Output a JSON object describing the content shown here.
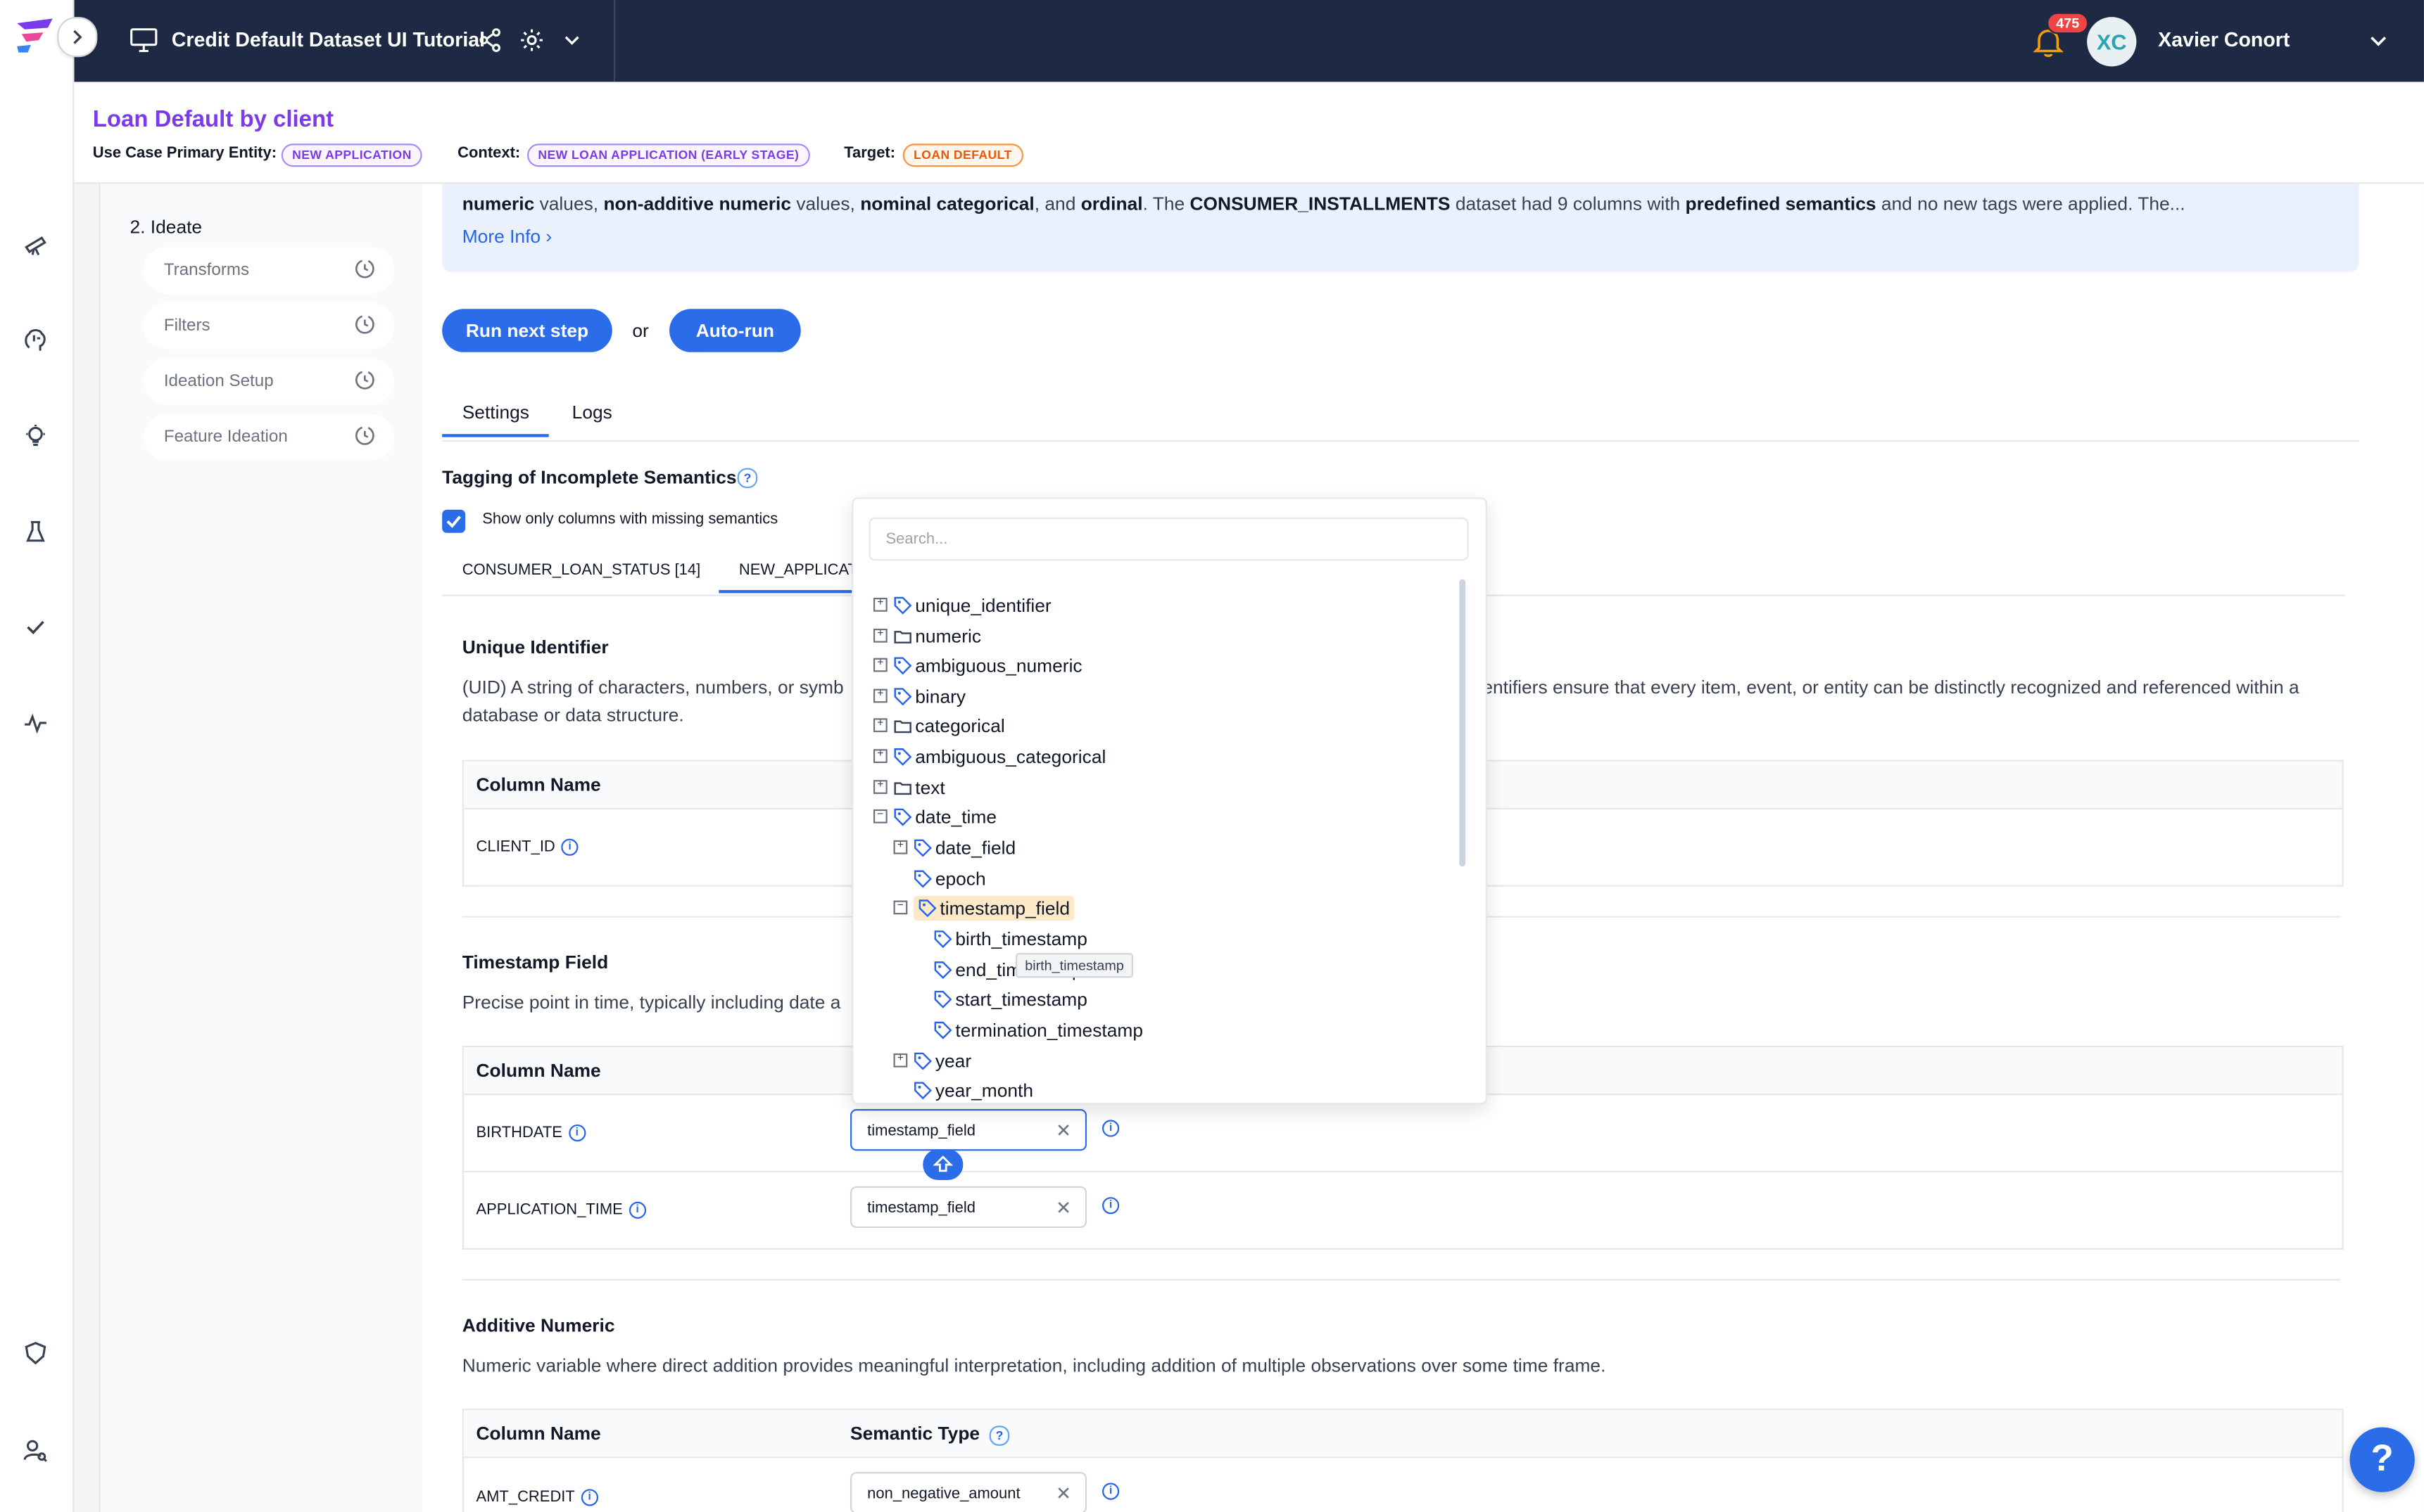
{
  "topbar": {
    "project_title": "Credit Default Dataset UI Tutorial",
    "notification_count": "475",
    "avatar_initials": "XC",
    "user_name": "Xavier Conort"
  },
  "header": {
    "title": "Loan Default by client",
    "entity_label": "Use Case Primary Entity:",
    "entity_value": "NEW APPLICATION",
    "context_label": "Context:",
    "context_value": "NEW LOAN APPLICATION (EARLY STAGE)",
    "target_label": "Target:",
    "target_value": "LOAN DEFAULT"
  },
  "steps": {
    "heading": "2. Ideate",
    "items": [
      {
        "label": "Transforms"
      },
      {
        "label": "Filters"
      },
      {
        "label": "Ideation Setup"
      },
      {
        "label": "Feature Ideation"
      }
    ]
  },
  "info": {
    "p1": "numeric",
    "p2": " values, ",
    "p3": "non-additive numeric",
    "p4": " values, ",
    "p5": "nominal categorical",
    "p6": ", and ",
    "p7": "ordinal",
    "p8": ". The ",
    "p9": "CONSUMER_INSTALLMENTS",
    "p10": " dataset had 9 columns with ",
    "p11": "predefined semantics",
    "p12": " and no new tags were applied. The...",
    "more": "More Info"
  },
  "actions": {
    "run_next": "Run next step",
    "or": "or",
    "auto_run": "Auto-run"
  },
  "tabs": [
    {
      "label": "Settings"
    },
    {
      "label": "Logs"
    }
  ],
  "tagging": {
    "title": "Tagging of Incomplete Semantics",
    "checkbox_label": "Show only columns with missing semantics",
    "ds_tabs": [
      {
        "label": "CONSUMER_LOAN_STATUS [14]"
      },
      {
        "label": "NEW_APPLICAT"
      }
    ]
  },
  "sections": {
    "uid": {
      "title": "Unique Identifier",
      "desc_l1a": "(UID) A string of characters, numbers, or symb",
      "desc_l1b": "entifiers ensure that every item, event, or entity can be distinctly recognized and referenced within a",
      "desc_l2": "database or data structure.",
      "col_header": "Column Name",
      "rows": [
        {
          "name": "CLIENT_ID"
        }
      ]
    },
    "timestamp": {
      "title": "Timestamp Field",
      "desc": "Precise point in time, typically including date a",
      "col_header": "Column Name",
      "rows": [
        {
          "name": "BIRTHDATE",
          "value": "timestamp_field"
        },
        {
          "name": "APPLICATION_TIME",
          "value": "timestamp_field"
        }
      ]
    },
    "additive": {
      "title": "Additive Numeric",
      "desc": "Numeric variable where direct addition provides meaningful interpretation, including addition of multiple observations over some time frame.",
      "col_header": "Column Name",
      "type_header": "Semantic Type",
      "rows": [
        {
          "name": "AMT_CREDIT",
          "value": "non_negative_amount"
        }
      ]
    }
  },
  "dropdown": {
    "search_placeholder": "Search...",
    "items": [
      {
        "label": "unique_identifier",
        "icon": "tag-icon"
      },
      {
        "label": "numeric",
        "icon": "folder-icon"
      },
      {
        "label": "ambiguous_numeric",
        "icon": "tag-icon"
      },
      {
        "label": "binary",
        "icon": "tag-icon"
      },
      {
        "label": "categorical",
        "icon": "folder-icon"
      },
      {
        "label": "ambiguous_categorical",
        "icon": "tag-icon"
      },
      {
        "label": "text",
        "icon": "folder-icon"
      },
      {
        "label": "date_time",
        "icon": "tag-icon"
      },
      {
        "label": "date_field",
        "icon": "tag-icon"
      },
      {
        "label": "epoch",
        "icon": "tag-icon"
      },
      {
        "label": "timestamp_field",
        "icon": "tag-icon"
      },
      {
        "label": "birth_timestamp",
        "icon": "tag-icon"
      },
      {
        "label": "end_timestamp",
        "icon": "tag-icon"
      },
      {
        "label": "start_timestamp",
        "icon": "tag-icon"
      },
      {
        "label": "termination_timestamp",
        "icon": "tag-icon"
      },
      {
        "label": "year",
        "icon": "tag-icon"
      },
      {
        "label": "year_month",
        "icon": "tag-icon"
      }
    ],
    "tooltip": "birth_timestamp"
  },
  "help_fab": "?",
  "colors": {
    "topbar": "#1e2a43",
    "accent": "#2b6de8",
    "title_purple": "#7c3aed",
    "target_orange": "#ea580c",
    "highlight": "#fde8c7"
  }
}
